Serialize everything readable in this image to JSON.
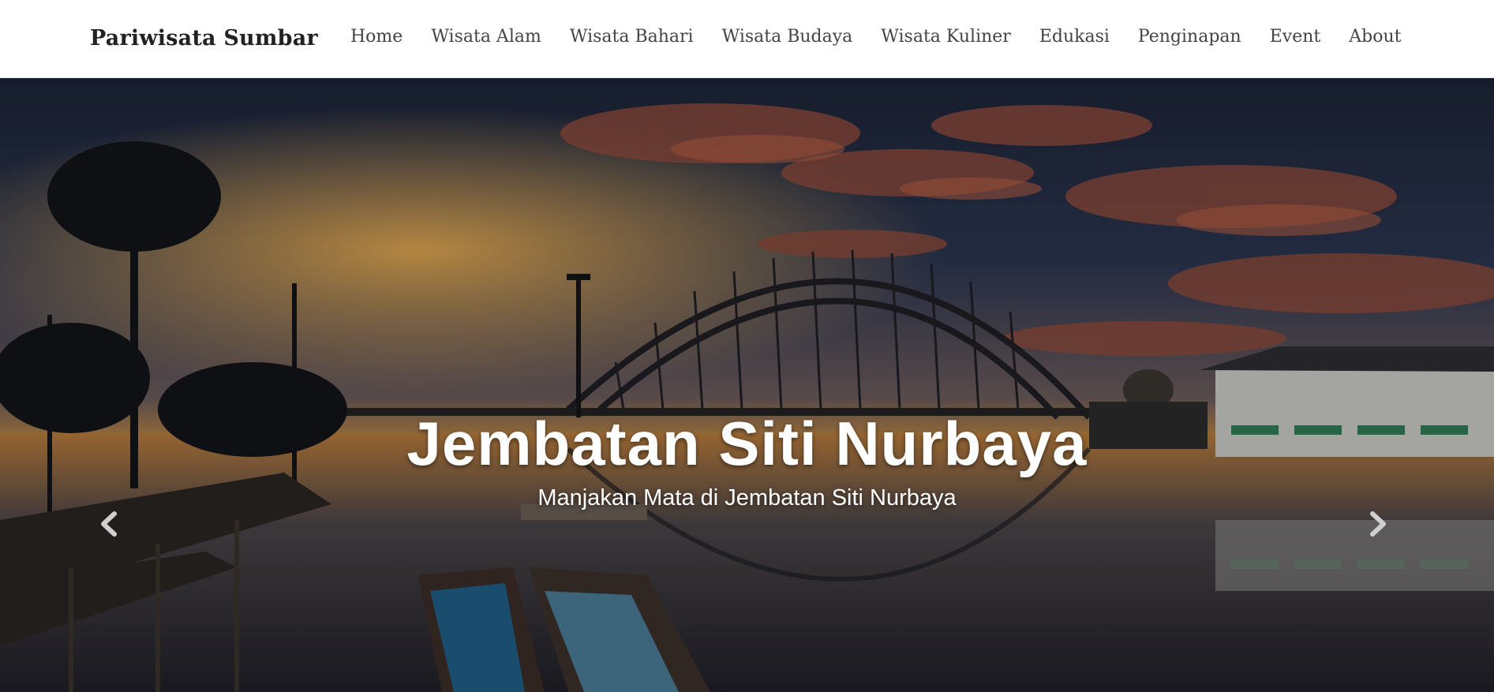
{
  "brand": "Pariwisata Sumbar",
  "nav": [
    "Home",
    "Wisata Alam",
    "Wisata Bahari",
    "Wisata Budaya",
    "Wisata Kuliner",
    "Edukasi",
    "Penginapan",
    "Event",
    "About"
  ],
  "hero": {
    "title": "Jembatan Siti Nurbaya",
    "subtitle": "Manjakan Mata di Jembatan Siti Nurbaya",
    "image_subject": "bridge-at-sunset-photo"
  },
  "icons": {
    "prev": "chevron-left-icon",
    "next": "chevron-right-icon"
  },
  "colors": {
    "navbar_bg": "#ffffff",
    "brand_text": "#222222",
    "nav_text": "#444444",
    "caption_text": "#ffffff"
  }
}
